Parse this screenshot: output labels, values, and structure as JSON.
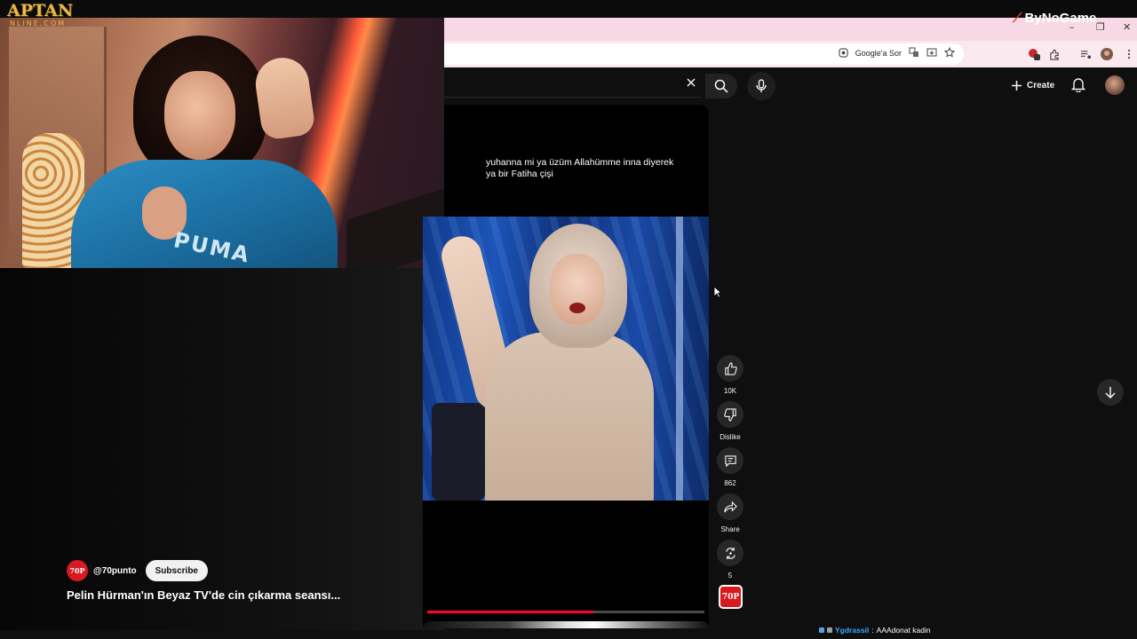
{
  "overlay": {
    "logo_main": "APTAN",
    "logo_sub": "NLINE.COM",
    "brand_right": "ByNoGame"
  },
  "browser": {
    "google_chip": "Google'a Sor",
    "window_minimize": "–",
    "window_restore": "❐",
    "window_close": "✕"
  },
  "header": {
    "create_label": "Create"
  },
  "short": {
    "caption": "yuhanna mi ya üzüm Allahümme inna diyerek ya bir Fatiha çişi",
    "progress": 0.6
  },
  "actions": {
    "like_count": "10K",
    "dislike_label": "Dislike",
    "comments_count": "862",
    "share_label": "Share",
    "remix_count": "5"
  },
  "channel": {
    "handle": "@70punto",
    "avatar_text": "70P",
    "subscribe_label": "Subscribe",
    "video_title": "Pelin Hürman'ın Beyaz TV'de cin çıkarma seansı..."
  },
  "chat": {
    "user": "Ygdrassil",
    "separator": ":",
    "message": "AAAdonat kadin"
  },
  "colors": {
    "accent": "#ff0033",
    "tabbar": "#f6d9e4",
    "background": "#0f0f0f"
  }
}
